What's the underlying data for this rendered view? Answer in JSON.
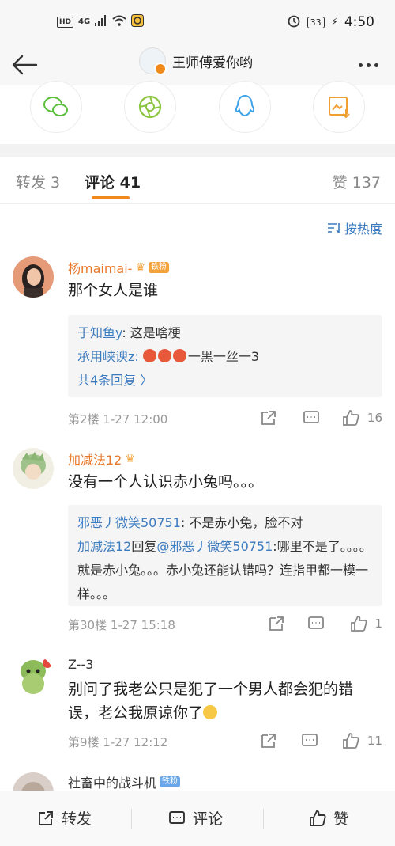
{
  "status_bar": {
    "network": "HD",
    "network_type": "4G",
    "battery": "33",
    "time": "4:50"
  },
  "nav": {
    "title": "王师傅爱你哟"
  },
  "tabs": {
    "repost": "转发 3",
    "comment": "评论 41",
    "like": "赞 137"
  },
  "sort_label": "按热度",
  "comments": [
    {
      "name": "杨maimai-",
      "badge": "铁粉",
      "text": "那个女人是谁",
      "replies": [
        {
          "name": "于知鱼y",
          "text": ": 这是啥梗"
        },
        {
          "name": "承用峡谀z",
          "text": "一黑一丝一3"
        }
      ],
      "more_replies": "共4条回复 〉",
      "floor": "第2楼  1-27 12:00",
      "likes": "16"
    },
    {
      "name": "加减法12",
      "text": "没有一个人认识赤小兔吗。。。",
      "replies": [
        {
          "name": "邪恶丿微笑50751",
          "text": ": 不是赤小兔，脸不对"
        },
        {
          "name": "加减法12",
          "mid": "回复",
          "to": "@邪恶丿微笑50751",
          "text": ":哪里不是了。。。。就是赤小兔。。。赤小兔还能认错吗？连指甲都一模一样。。。"
        }
      ],
      "floor": "第30楼  1-27 15:18",
      "likes": "1"
    },
    {
      "name": "Z--3",
      "text": "别问了我老公只是犯了一个男人都会犯的错误，老公我原谅你了",
      "floor": "第9楼  1-27 12:12",
      "likes": "11"
    },
    {
      "name": "社畜中的战斗机",
      "badge": "铁粉"
    }
  ],
  "bottom_bar": {
    "repost": "转发",
    "comment": "评论",
    "like": "赞"
  }
}
